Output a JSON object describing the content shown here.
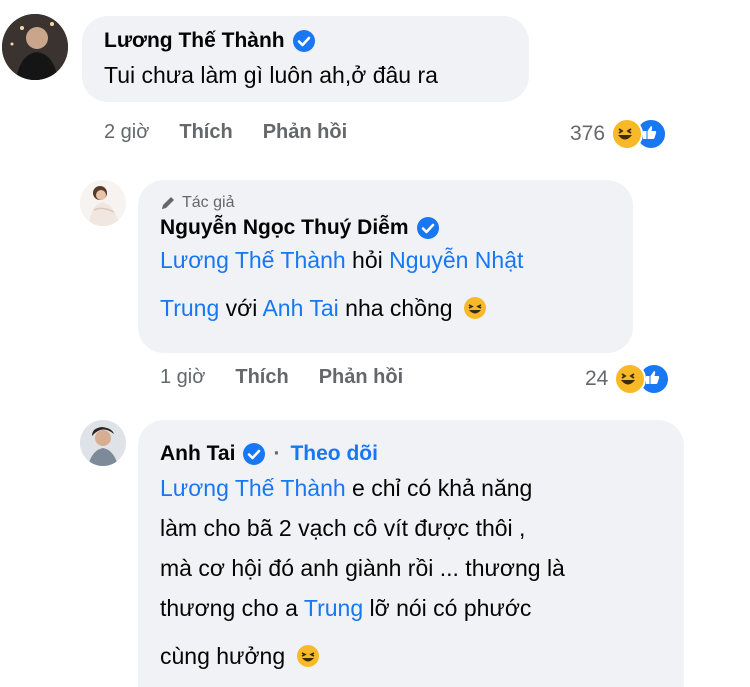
{
  "comment1": {
    "author": "Lương Thế Thành",
    "text": "Tui chưa làm gì luôn ah,ở đâu ra",
    "time": "2 giờ",
    "like_label": "Thích",
    "reply_label": "Phản hồi",
    "reaction_count": "376"
  },
  "comment2": {
    "badge": "Tác giả",
    "author": "Nguyễn Ngọc Thuý Diễm",
    "mention1": "Lương Thế Thành",
    "t1": " hỏi ",
    "mention2": "Nguyễn Nhật",
    "mention2b": "Trung",
    "t2": " với ",
    "mention3": "Anh Tai",
    "t3": " nha chồng",
    "time": "1 giờ",
    "like_label": "Thích",
    "reply_label": "Phản hồi",
    "reaction_count": "24"
  },
  "comment3": {
    "author": "Anh Tai",
    "separator": "·",
    "follow_label": "Theo dõi",
    "mention1": "Lương Thế Thành",
    "l1": " e chỉ có khả năng",
    "l2": "làm cho bã 2 vạch cô vít được thôi ,",
    "l3": "mà cơ hội đó anh giành rồi ... thương là",
    "l4a": "thương cho a ",
    "mention2": "Trung",
    "l4b": " lỡ nói có phước",
    "l5": "cùng hưởng"
  },
  "colors": {
    "accent": "#1877f2",
    "bubble": "#f0f2f5",
    "muted": "#65676b"
  },
  "icons": [
    "verified-icon",
    "pen-icon",
    "laugh-emoji-icon",
    "like-icon"
  ]
}
